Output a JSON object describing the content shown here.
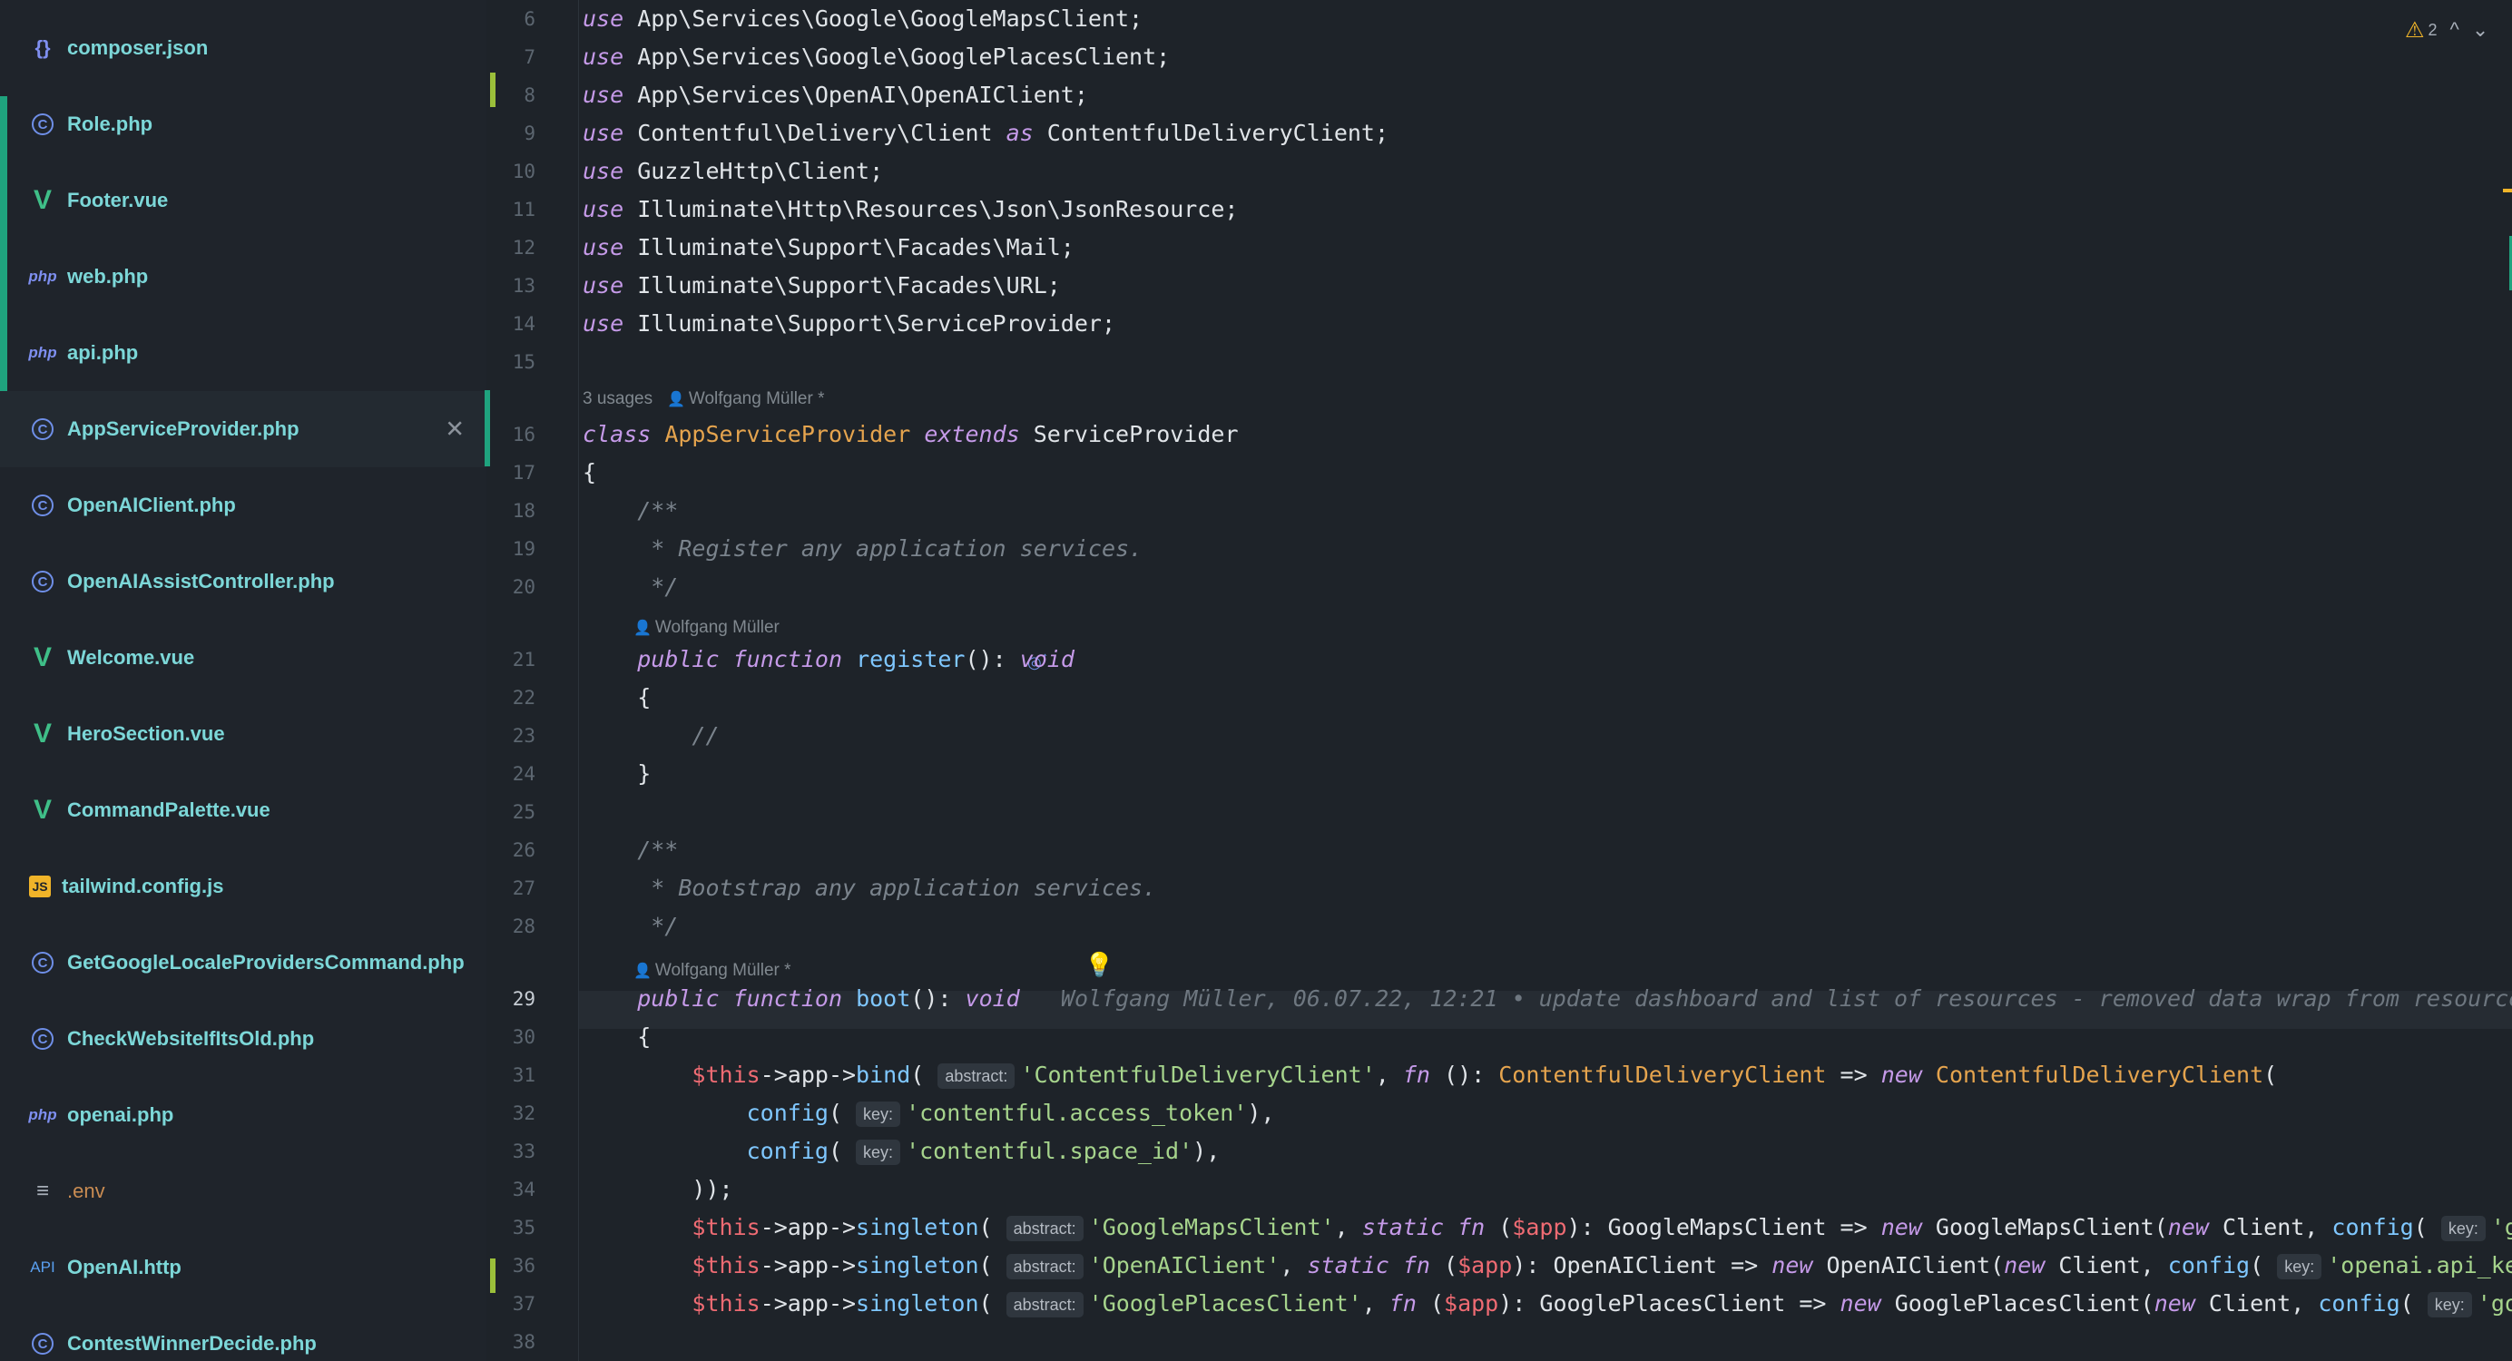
{
  "sidebar": {
    "files": [
      {
        "name": "composer.json",
        "icon": "json-braces-icon",
        "type": "json"
      },
      {
        "name": "Role.php",
        "icon": "class-c-icon",
        "type": "c"
      },
      {
        "name": "Footer.vue",
        "icon": "vue-icon",
        "type": "vue"
      },
      {
        "name": "web.php",
        "icon": "php-icon",
        "type": "php"
      },
      {
        "name": "api.php",
        "icon": "php-icon",
        "type": "php"
      },
      {
        "name": "AppServiceProvider.php",
        "icon": "class-c-icon",
        "type": "c",
        "active": true
      },
      {
        "name": "OpenAIClient.php",
        "icon": "class-c-icon",
        "type": "c"
      },
      {
        "name": "OpenAIAssistController.php",
        "icon": "class-c-icon",
        "type": "c"
      },
      {
        "name": "Welcome.vue",
        "icon": "vue-icon",
        "type": "vue"
      },
      {
        "name": "HeroSection.vue",
        "icon": "vue-icon",
        "type": "vue"
      },
      {
        "name": "CommandPalette.vue",
        "icon": "vue-icon",
        "type": "vue"
      },
      {
        "name": "tailwind.config.js",
        "icon": "js-icon",
        "type": "js"
      },
      {
        "name": "GetGoogleLocaleProvidersCommand.php",
        "icon": "class-c-icon",
        "type": "c"
      },
      {
        "name": "CheckWebsiteIfItsOld.php",
        "icon": "class-c-icon",
        "type": "c"
      },
      {
        "name": "openai.php",
        "icon": "php-icon",
        "type": "php"
      },
      {
        "name": ".env",
        "icon": "text-lines-icon",
        "type": "env"
      },
      {
        "name": "OpenAI.http",
        "icon": "api-icon",
        "type": "api"
      },
      {
        "name": "ContestWinnerDecide.php",
        "icon": "class-c-icon",
        "type": "c"
      }
    ],
    "close_glyph": "✕",
    "icon_glyphs": {
      "json": "{}",
      "c": "C",
      "vue": "V",
      "php": "php",
      "js": "JS",
      "env": "≡",
      "api": "API"
    }
  },
  "editor": {
    "warnings": {
      "count": "2",
      "icon": "warning-triangle-icon",
      "up": "^",
      "down": "⌄"
    },
    "line_numbers": [
      "6",
      "7",
      "8",
      "9",
      "10",
      "11",
      "12",
      "13",
      "14",
      "15",
      "16",
      "17",
      "18",
      "19",
      "20",
      "21",
      "22",
      "23",
      "24",
      "25",
      "26",
      "27",
      "28",
      "29",
      "30",
      "31",
      "32",
      "33",
      "34",
      "35",
      "36",
      "37",
      "38"
    ],
    "current_line": "29",
    "inlays": {
      "class_usage": "3 usages",
      "class_author": "Wolfgang Müller *",
      "register_author": "Wolfgang Müller",
      "boot_author": "Wolfgang Müller *",
      "person_icon": "👤"
    },
    "blame": "Wolfgang Müller, 06.07.22, 12:21 • update dashboard and list of resources - removed data wrap from resource coll",
    "hints": {
      "abstract": "abstract:",
      "key": "key:"
    },
    "code": {
      "l6": [
        "use",
        " App\\Services\\Google\\GoogleMapsClient;"
      ],
      "l7": [
        "use",
        " App\\Services\\Google\\GooglePlacesClient;"
      ],
      "l8": [
        "use",
        " App\\Services\\OpenAI\\OpenAIClient;"
      ],
      "l9": [
        "use",
        " Contentful\\Delivery\\Client ",
        "as",
        " ContentfulDeliveryClient;"
      ],
      "l10": [
        "use",
        " GuzzleHttp\\Client;"
      ],
      "l11": [
        "use",
        " Illuminate\\Http\\Resources\\Json\\JsonResource;"
      ],
      "l12": [
        "use",
        " Illuminate\\Support\\Facades\\Mail;"
      ],
      "l13": [
        "use",
        " Illuminate\\Support\\Facades\\URL;"
      ],
      "l14": [
        "use",
        " Illuminate\\Support\\ServiceProvider;"
      ],
      "l16": [
        "class",
        " ",
        "AppServiceProvider",
        " ",
        "extends",
        " ServiceProvider"
      ],
      "l17": "{",
      "l18": "    /**",
      "l19": "     * Register any application services.",
      "l20": "     */",
      "l21": [
        "    ",
        "public",
        " ",
        "function",
        " ",
        "register",
        "(): ",
        "void"
      ],
      "l22": "    {",
      "l23": "        //",
      "l24": "    }",
      "l26": "    /**",
      "l27": "     * Bootstrap any application services.",
      "l28": "     */",
      "l29": [
        "    ",
        "public",
        " ",
        "function",
        " ",
        "boot",
        "(): ",
        "void"
      ],
      "l30": "    {",
      "l31": [
        "        ",
        "$this",
        "->app->",
        "bind",
        "( ",
        "'ContentfulDeliveryClient'",
        ", ",
        "fn",
        " (): ",
        "ContentfulDeliveryClient",
        " => ",
        "new",
        " ",
        "ContentfulDeliveryClient",
        "("
      ],
      "l32": [
        "            ",
        "config",
        "( ",
        "'contentful.access_token'",
        "),"
      ],
      "l33": [
        "            ",
        "config",
        "( ",
        "'contentful.space_id'",
        "),"
      ],
      "l34": "        ));",
      "l35": [
        "        ",
        "$this",
        "->app->",
        "singleton",
        "( ",
        "'GoogleMapsClient'",
        ", ",
        "static",
        " ",
        "fn",
        " (",
        "$app",
        "): GoogleMapsClient => ",
        "new",
        " GoogleMapsClient(",
        "new",
        " Client, ",
        "config",
        "( ",
        "'google"
      ],
      "l36": [
        "        ",
        "$this",
        "->app->",
        "singleton",
        "( ",
        "'OpenAIClient'",
        ", ",
        "static",
        " ",
        "fn",
        " (",
        "$app",
        "): OpenAIClient => ",
        "new",
        " OpenAIClient(",
        "new",
        " Client, ",
        "config",
        "( ",
        "'openai.api_key'",
        "),"
      ],
      "l37": [
        "        ",
        "$this",
        "->app->",
        "singleton",
        "( ",
        "'GooglePlacesClient'",
        ", ",
        "fn",
        " (",
        "$app",
        "): GooglePlacesClient => ",
        "new",
        " GooglePlacesClient(",
        "new",
        " Client, ",
        "config",
        "( ",
        "'google."
      ]
    }
  },
  "colors": {
    "background": "#1e2329",
    "accent_green": "#1fa37e",
    "filename": "#7cd7d8",
    "keyword": "#c59ae8",
    "class_name": "#e5a44e",
    "function": "#7fc7ff",
    "string": "#a6d48c",
    "comment": "#7a838c",
    "variable": "#ef6b73",
    "warning": "#f0b429"
  }
}
